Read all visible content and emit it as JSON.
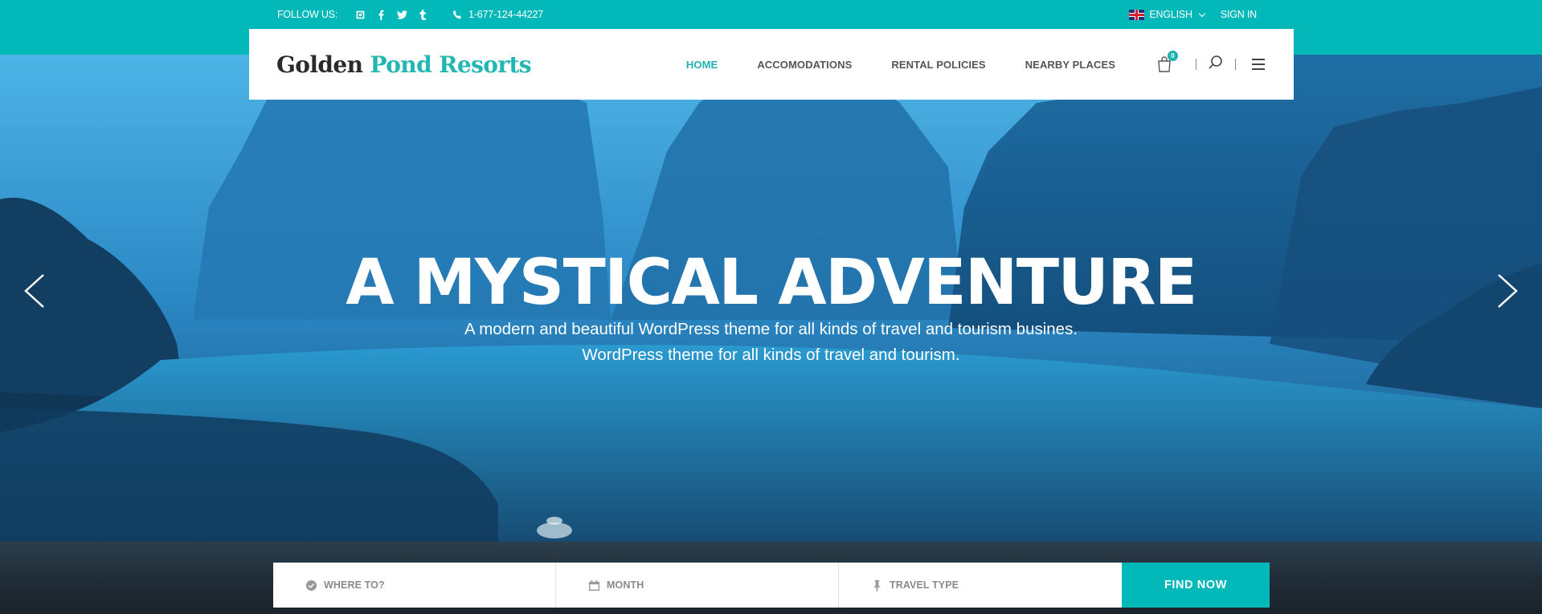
{
  "topbar": {
    "follow_label": "FOLLOW US:",
    "social_icons": [
      "instagram-icon",
      "facebook-icon",
      "twitter-icon",
      "tumblr-icon"
    ],
    "phone": "1-677-124-44227",
    "language": "ENGLISH",
    "signin": "SIGN IN"
  },
  "header": {
    "logo_main": "Golden",
    "logo_accent": "Pond Resorts",
    "nav": [
      "HOME",
      "ACCOMODATIONS",
      "RENTAL POLICIES",
      "NEARBY PLACES"
    ],
    "active_nav": "HOME",
    "cart_count": "0"
  },
  "slide": {
    "title": "A MYSTICAL ADVENTURE",
    "subtitle_line1": "A modern and beautiful WordPress theme for all kinds of travel and tourism busines.",
    "subtitle_line2": "WordPress theme for all kinds of travel and tourism."
  },
  "search": {
    "where_placeholder": "WHERE TO?",
    "month_placeholder": "MONTH",
    "type_placeholder": "TRAVEL TYPE",
    "button": "FIND NOW"
  },
  "colors": {
    "accent": "#03b8b8",
    "logo_accent": "#22b7b3",
    "text_dark": "#2b2b2b"
  }
}
